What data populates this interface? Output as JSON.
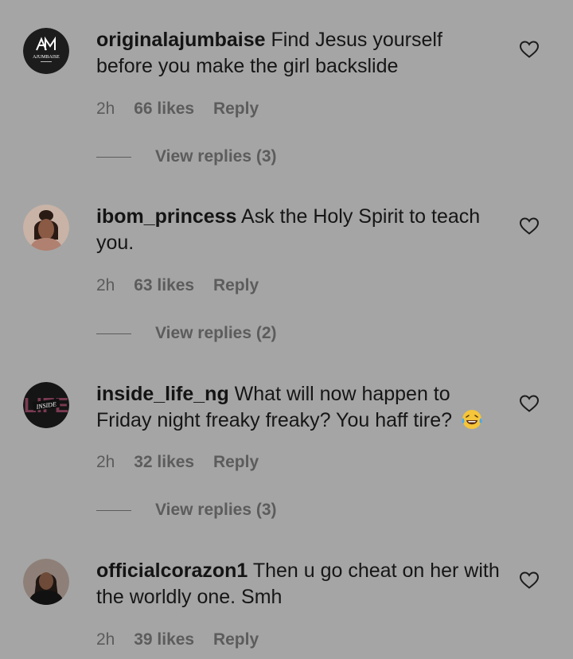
{
  "comments": [
    {
      "username": "originalajumbaise",
      "text": "Find Jesus yourself before you make the girl backslide",
      "time": "2h",
      "likes": "66 likes",
      "reply": "Reply",
      "view_replies": "View replies (3)",
      "avatar_logo": "AJUMBAISE"
    },
    {
      "username": "ibom_princess",
      "text": "Ask the Holy Spirit to teach you.",
      "time": "2h",
      "likes": "63 likes",
      "reply": "Reply",
      "view_replies": "View replies (2)"
    },
    {
      "username": "inside_life_ng",
      "text": "What will now happen to Friday night freaky freaky? You haff tire?",
      "emoji": "laughing-tears-emoji",
      "time": "2h",
      "likes": "32 likes",
      "reply": "Reply",
      "view_replies": "View replies (3)",
      "avatar_logo": "INSIDE"
    },
    {
      "username": "officialcorazon1",
      "text": "Then u go cheat on her with the worldly one. Smh",
      "time": "2h",
      "likes": "39 likes",
      "reply": "Reply"
    }
  ],
  "colors": {
    "background": "#a5a5a5",
    "primary_text": "#141414",
    "secondary_text": "#5c5c5c"
  }
}
